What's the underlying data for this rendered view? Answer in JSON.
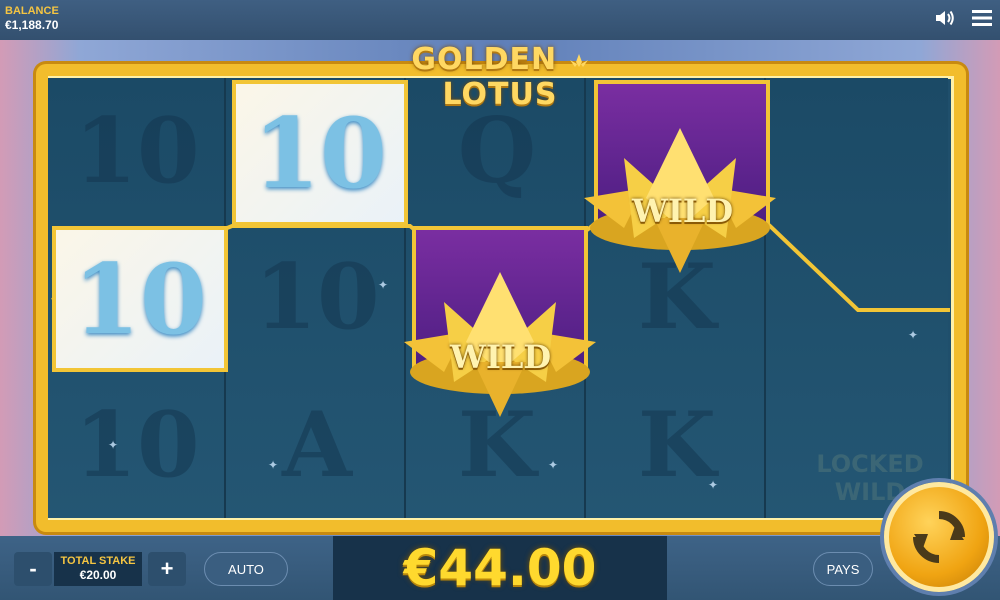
{
  "top_bar": {
    "balance_label": "BALANCE",
    "balance_value": "€1,188.70",
    "sound_icon": "speaker-icon",
    "menu_icon": "hamburger-menu-icon"
  },
  "game": {
    "title": "GOLDEN LOTUS",
    "title_left": "GOLDEN",
    "title_right": "LOTUS",
    "symbols": {
      "ten": "10",
      "wild": "WILD",
      "queen": "Q",
      "king": "K",
      "ace": "A"
    },
    "locked_wild_line1": "LOCKED",
    "locked_wild_line2": "WILD"
  },
  "bottom_bar": {
    "minus_label": "-",
    "plus_label": "+",
    "stake_label": "TOTAL STAKE",
    "stake_value": "€20.00",
    "auto_label": "AUTO",
    "win_amount": "€44.00",
    "pays_label": "PAYS",
    "spin_icon": "spin-refresh-icon"
  },
  "colors": {
    "accent_gold": "#f2bd2c",
    "win_text": "#ffd92e",
    "wild_purple": "#6a2a9a",
    "bar_blue": "#3e6387"
  }
}
